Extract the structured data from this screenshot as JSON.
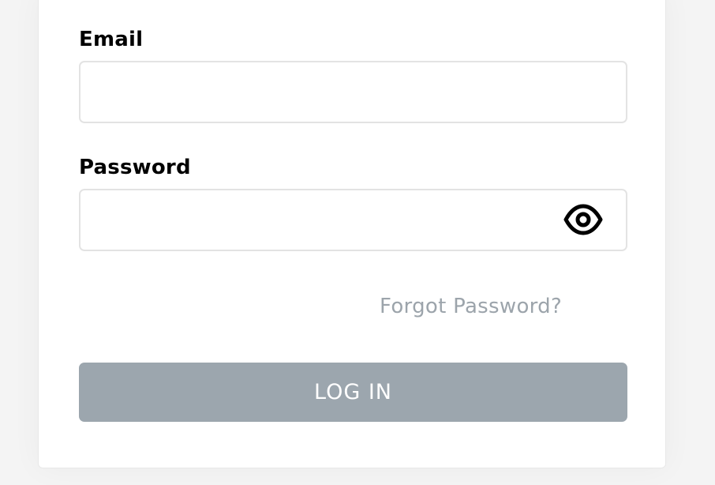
{
  "form": {
    "email_label": "Email",
    "email_value": "",
    "password_label": "Password",
    "password_value": "",
    "forgot_password": "Forgot Password?",
    "login_button": "LOG IN"
  },
  "icons": {
    "password_toggle": "eye-icon"
  },
  "colors": {
    "button_background": "#9ca6ae",
    "link_text": "#9ca4ab"
  }
}
